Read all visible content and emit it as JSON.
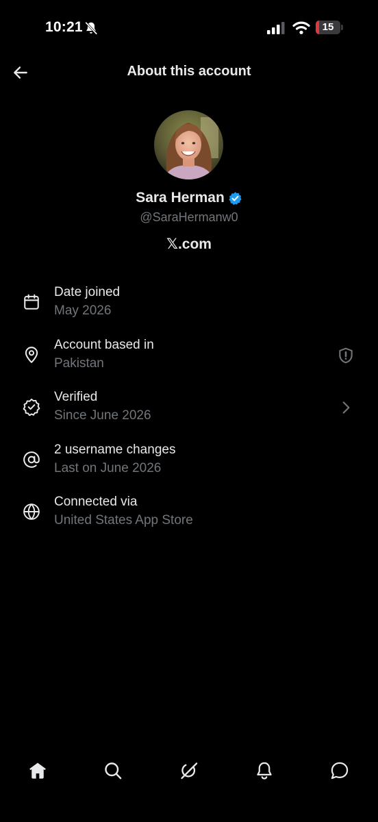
{
  "status_bar": {
    "time": "10:21",
    "battery_level": "15",
    "battery_color": "#e0383e"
  },
  "header": {
    "title": "About this account",
    "back_icon": "arrow-left-icon"
  },
  "profile": {
    "display_name": "Sara Herman",
    "handle": "@SaraHermanw0",
    "site": "𝕏.com",
    "verified_color": "#1d9bf0"
  },
  "info_rows": [
    {
      "icon": "calendar-icon",
      "title": "Date joined",
      "value": "May 2026"
    },
    {
      "icon": "location-pin-icon",
      "title": "Account based in",
      "value": "Pakistan",
      "trailing_icon": "shield-alert-icon"
    },
    {
      "icon": "verified-check-icon",
      "title": "Verified",
      "value": "Since June 2026",
      "trailing_icon": "chevron-right-icon"
    },
    {
      "icon": "at-sign-icon",
      "title": "2 username changes",
      "value": "Last on June 2026"
    },
    {
      "icon": "globe-icon",
      "title": "Connected via",
      "value": "United States App Store"
    }
  ],
  "bottom_nav": [
    {
      "name": "home",
      "icon": "home-icon",
      "active": true
    },
    {
      "name": "search",
      "icon": "search-icon"
    },
    {
      "name": "grok",
      "icon": "grok-icon"
    },
    {
      "name": "notifications",
      "icon": "bell-icon"
    },
    {
      "name": "messages",
      "icon": "message-icon"
    }
  ],
  "colors": {
    "background": "#000000",
    "primary_text": "#e7e9ea",
    "secondary_text": "#71767b"
  }
}
